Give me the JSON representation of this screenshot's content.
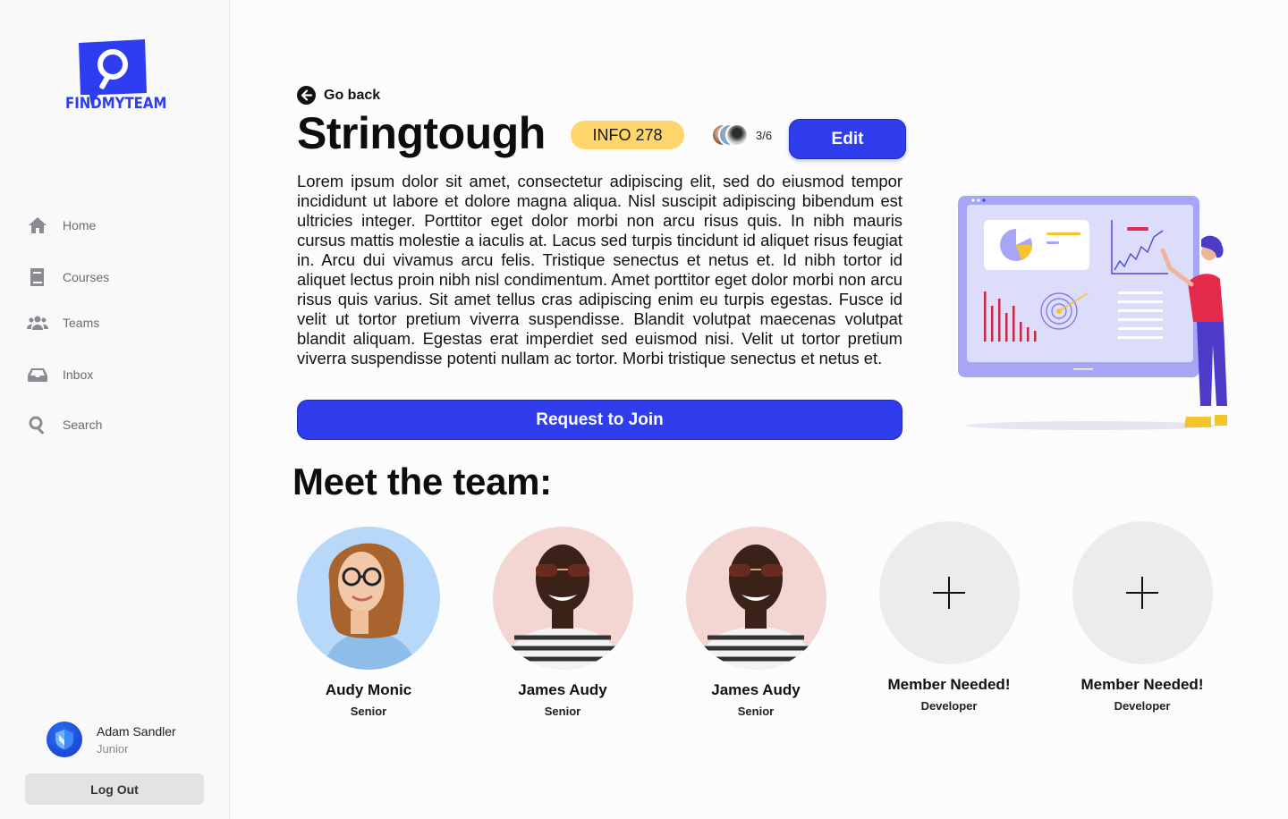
{
  "brand": {
    "name": "FINDMYTEAM",
    "color": "#2f3df0"
  },
  "sidebar": {
    "items": [
      {
        "label": "Home",
        "icon": "home-icon"
      },
      {
        "label": "Courses",
        "icon": "book-icon"
      },
      {
        "label": "Teams",
        "icon": "users-icon"
      },
      {
        "label": "Inbox",
        "icon": "inbox-icon"
      },
      {
        "label": "Search",
        "icon": "search-icon"
      }
    ],
    "user": {
      "name": "Adam Sandler",
      "role": "Junior"
    },
    "logout_label": "Log Out"
  },
  "team": {
    "go_back_label": "Go back",
    "title": "Stringtough",
    "badge": "INFO 278",
    "member_count": "3/6",
    "edit_label": "Edit",
    "description": "Lorem ipsum dolor sit amet, consectetur adipiscing elit, sed do eiusmod tempor incididunt ut labore et dolore magna aliqua. Nisl suscipit adipiscing bibendum est ultricies integer. Porttitor eget dolor morbi non arcu risus quis. In nibh mauris cursus mattis molestie a iaculis at. Lacus sed turpis tincidunt id aliquet risus feugiat in. Arcu dui vivamus arcu felis. Tristique senectus et netus et. Id nibh tortor id aliquet lectus proin nibh nisl condimentum. Amet porttitor eget dolor morbi non arcu risus quis varius. Sit amet tellus cras adipiscing enim eu turpis egestas. Fusce id velit ut tortor pretium viverra suspendisse. Blandit volutpat maecenas volutpat blandit aliquam. Egestas erat imperdiet sed euismod nisi. Velit ut tortor pretium viverra suspendisse potenti nullam ac tortor. Morbi tristique senectus et netus et.",
    "join_label": "Request to Join",
    "accent_color": "#2f3ded",
    "badge_color": "#ffd66b"
  },
  "meet": {
    "heading": "Meet the team:",
    "members": [
      {
        "name": "Audy Monic",
        "role": "Senior"
      },
      {
        "name": "James Audy",
        "role": "Senior"
      },
      {
        "name": "James Audy",
        "role": "Senior"
      }
    ],
    "open_slots": [
      {
        "name": "Member Needed!",
        "role": "Developer"
      },
      {
        "name": "Member Needed!",
        "role": "Developer"
      }
    ]
  }
}
